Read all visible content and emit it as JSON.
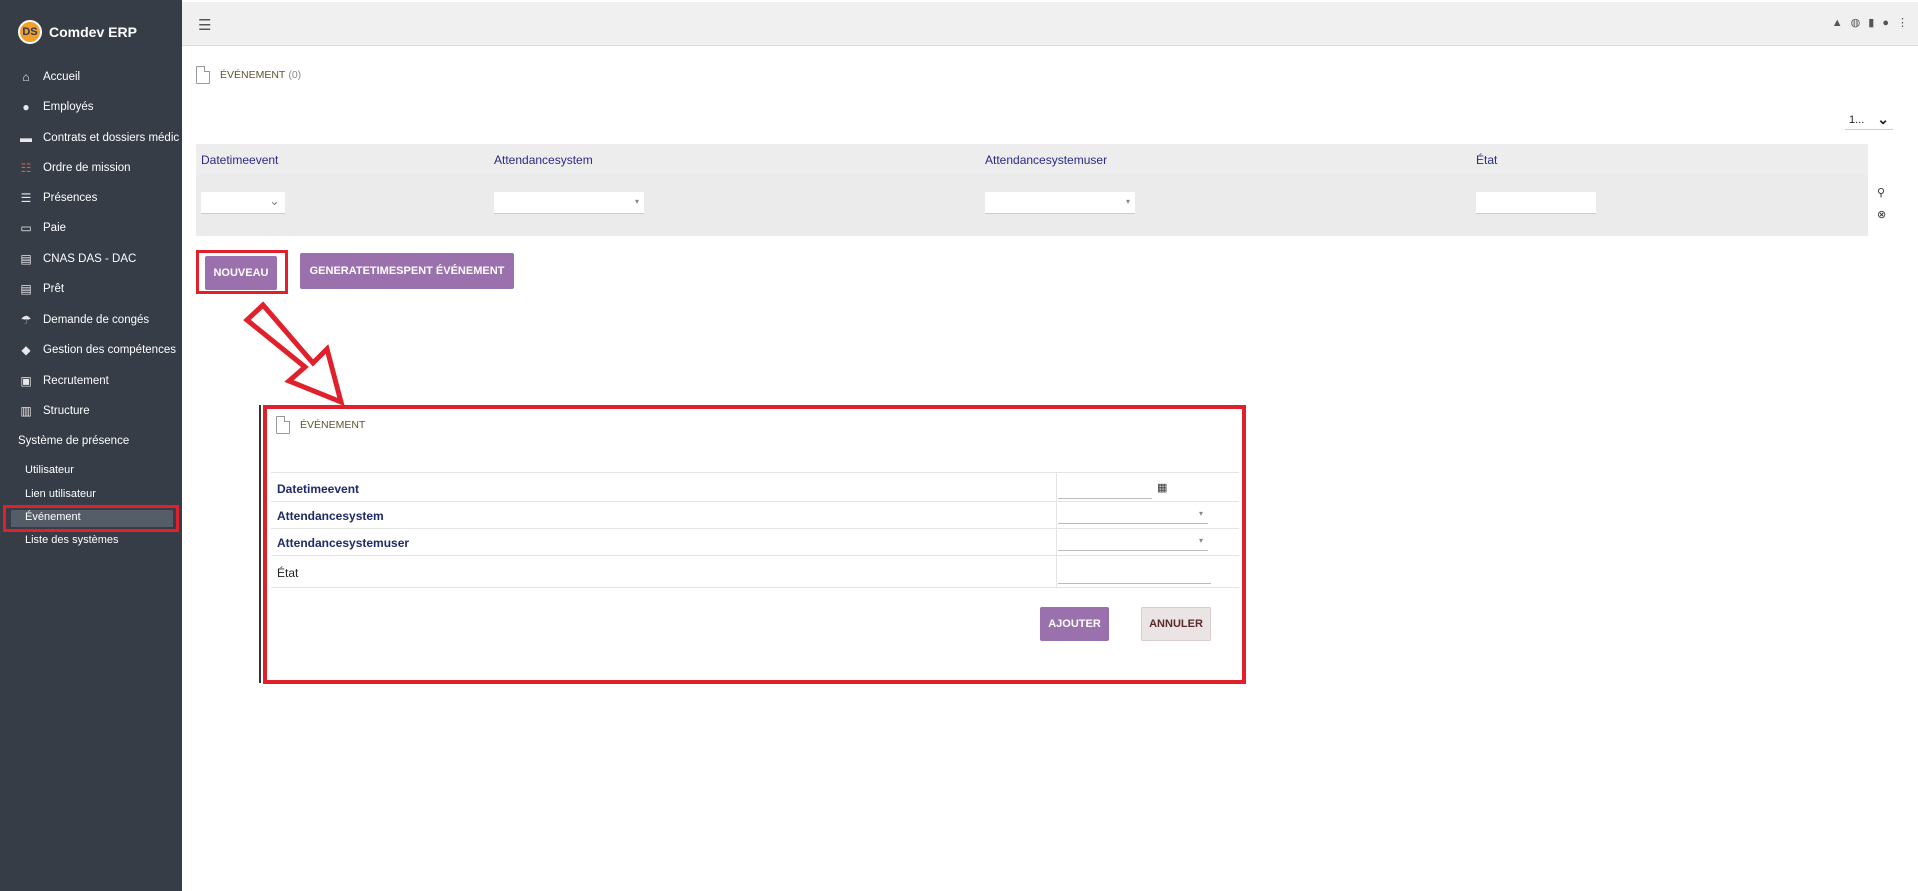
{
  "app": {
    "name": "Comdev ERP",
    "logo_text": "DS"
  },
  "sidebar": {
    "items": [
      {
        "label": "Accueil",
        "icon": "home-icon",
        "glyph": "⌂"
      },
      {
        "label": "Employés",
        "icon": "user-icon",
        "glyph": "●"
      },
      {
        "label": "Contrats et dossiers médic",
        "icon": "folder-icon",
        "glyph": "▬"
      },
      {
        "label": "Ordre de mission",
        "icon": "checklist-icon",
        "glyph": "☷"
      },
      {
        "label": "Présences",
        "icon": "list-icon",
        "glyph": "☰"
      },
      {
        "label": "Paie",
        "icon": "money-icon",
        "glyph": "▭"
      },
      {
        "label": "CNAS DAS - DAC",
        "icon": "document-icon",
        "glyph": "▤"
      },
      {
        "label": "Prêt",
        "icon": "document-icon",
        "glyph": "▤"
      },
      {
        "label": "Demande de congés",
        "icon": "umbrella-icon",
        "glyph": "☂"
      },
      {
        "label": "Gestion des compétences",
        "icon": "shapes-icon",
        "glyph": "◆"
      },
      {
        "label": "Recrutement",
        "icon": "id-card-icon",
        "glyph": "▣"
      },
      {
        "label": "Structure",
        "icon": "building-icon",
        "glyph": "▥"
      }
    ],
    "section_title": "Système de présence",
    "sub_items": [
      {
        "label": "Utilisateur"
      },
      {
        "label": "Lien utilisateur"
      },
      {
        "label": "Événement",
        "active": true
      },
      {
        "label": "Liste des systèmes"
      }
    ]
  },
  "topbar": {
    "menu_glyph": "☰",
    "icons": [
      {
        "name": "notification-icon",
        "glyph": "▲"
      },
      {
        "name": "chat-icon",
        "glyph": "◍"
      },
      {
        "name": "clipboard-icon",
        "glyph": "▮"
      },
      {
        "name": "user-avatar-icon",
        "glyph": "●"
      },
      {
        "name": "more-vertical-icon",
        "glyph": "⋮"
      }
    ]
  },
  "page": {
    "title": "ÉVÉNEMENT",
    "count": "(0)"
  },
  "pager": {
    "value": "1...",
    "caret": "⌄"
  },
  "grid": {
    "columns": [
      "Datetimeevent",
      "Attendancesystem",
      "Attendancesystemuser",
      "État"
    ],
    "search_glyph": "⚲",
    "clear_glyph": "⊗",
    "dropdown_caret": "▾",
    "select_caret": "⌄"
  },
  "buttons": {
    "nouveau": "NOUVEAU",
    "generate": "GENERATETIMESPENT ÉVÉNEMENT"
  },
  "dialog": {
    "title": "ÉVÉNEMENT",
    "fields": [
      {
        "label": "Datetimeevent",
        "bold": true,
        "kind": "date"
      },
      {
        "label": "Attendancesystem",
        "bold": true,
        "kind": "select"
      },
      {
        "label": "Attendancesystemuser",
        "bold": true,
        "kind": "select"
      },
      {
        "label": "État",
        "bold": false,
        "kind": "text"
      }
    ],
    "calendar_glyph": "▦",
    "ajouter": "AJOUTER",
    "annuler": "ANNULER"
  },
  "colors": {
    "sidebar_bg": "#363d47",
    "accent": "#9a70ad",
    "highlight": "#e0202a"
  }
}
